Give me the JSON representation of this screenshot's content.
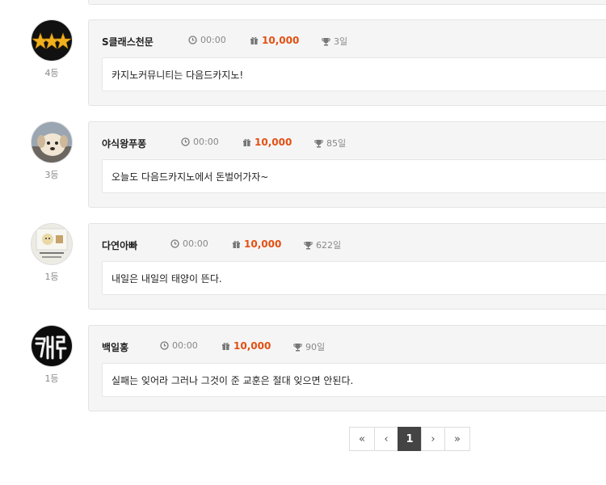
{
  "comments": [
    {
      "name": "S클래스천문",
      "time": "00:00",
      "points": "10,000",
      "days": "3일",
      "rank": "4등",
      "message": "카지노커뮤니티는 다음드카지노!",
      "avatar": "three-stars-avatar"
    },
    {
      "name": "야식왕푸퐁",
      "time": "00:00",
      "points": "10,000",
      "days": "85일",
      "rank": "3등",
      "message": "오늘도 다음드카지노에서 돈벌어가자~",
      "avatar": "puppy-avatar"
    },
    {
      "name": "다연아빠",
      "time": "00:00",
      "points": "10,000",
      "days": "622일",
      "rank": "1등",
      "message": "내일은 내일의 태양이 뜬다.",
      "avatar": "character-avatar"
    },
    {
      "name": "백일홍",
      "time": "00:00",
      "points": "10,000",
      "days": "90일",
      "rank": "1등",
      "message": "실패는 잊어라 그러나 그것이 준 교훈은 절대 잊으면 안된다.",
      "avatar": "neon-text-avatar"
    }
  ],
  "pagination": {
    "first": "«",
    "prev": "‹",
    "current": "1",
    "next": "›",
    "last": "»"
  },
  "colors": {
    "points": "#e34f12",
    "active_page": "#444444"
  }
}
